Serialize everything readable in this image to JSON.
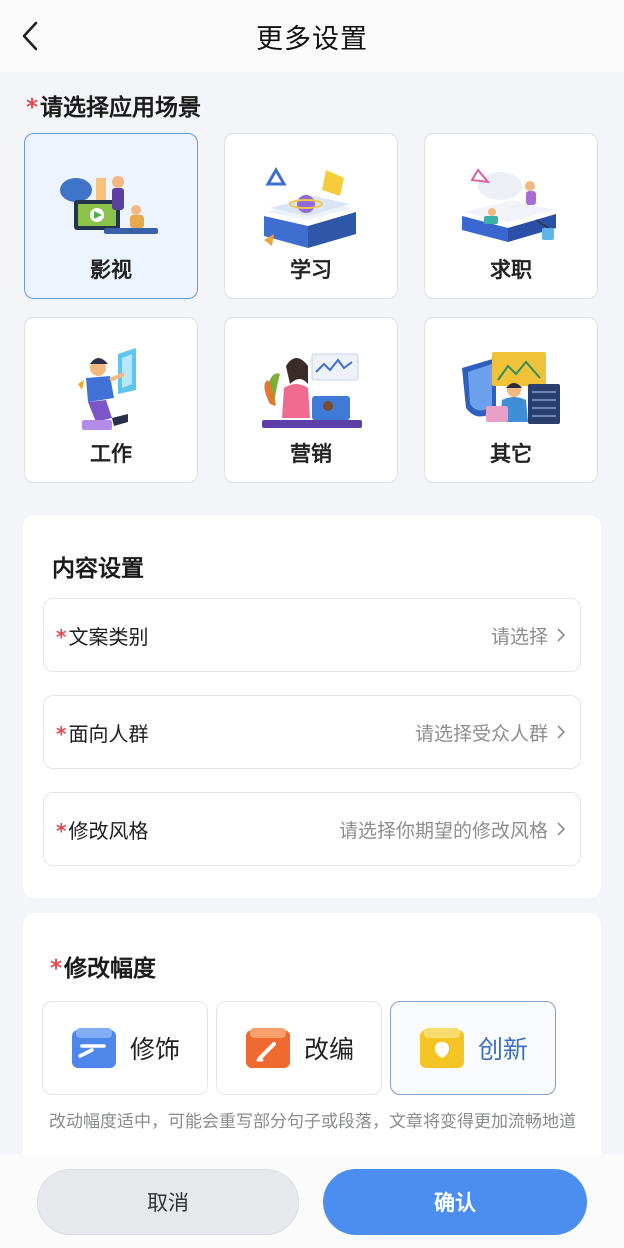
{
  "header": {
    "title": "更多设置"
  },
  "scene": {
    "required_mark": "*",
    "title": "请选择应用场景",
    "items": [
      {
        "label": "影视",
        "icon": "film-illustration",
        "selected": true
      },
      {
        "label": "学习",
        "icon": "study-book-illustration",
        "selected": false
      },
      {
        "label": "求职",
        "icon": "job-search-illustration",
        "selected": false
      },
      {
        "label": "工作",
        "icon": "work-illustration",
        "selected": false
      },
      {
        "label": "营销",
        "icon": "marketing-illustration",
        "selected": false
      },
      {
        "label": "其它",
        "icon": "other-illustration",
        "selected": false
      }
    ]
  },
  "content": {
    "title": "内容设置",
    "fields": [
      {
        "required_mark": "*",
        "label": "文案类别",
        "value": "请选择"
      },
      {
        "required_mark": "*",
        "label": "面向人群",
        "value": "请选择受众人群"
      },
      {
        "required_mark": "*",
        "label": "修改风格",
        "value": "请选择你期望的修改风格"
      }
    ]
  },
  "modify": {
    "required_mark": "*",
    "title": "修改幅度",
    "options": [
      {
        "label": "修饰",
        "icon": "polish-icon",
        "selected": false
      },
      {
        "label": "改编",
        "icon": "edit-icon",
        "selected": false
      },
      {
        "label": "创新",
        "icon": "innovate-icon",
        "selected": true
      }
    ],
    "description": "改动幅度适中，可能会重写部分句子或段落，文章将变得更加流畅地道"
  },
  "footer": {
    "cancel_label": "取消",
    "confirm_label": "确认"
  },
  "colors": {
    "accent": "#4b8ef0",
    "required": "#e5484d",
    "selected_border": "#6f99d9"
  }
}
